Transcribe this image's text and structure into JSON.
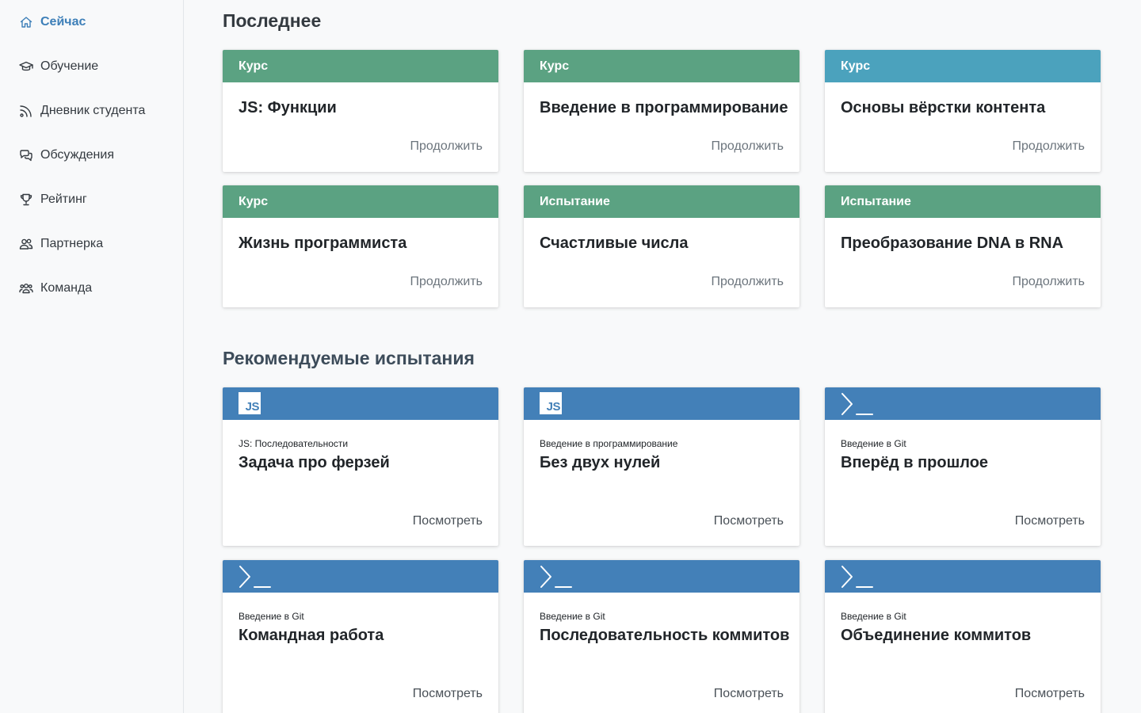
{
  "sidebar": {
    "items": [
      {
        "label": "Сейчас",
        "icon": "home-icon",
        "active": true
      },
      {
        "label": "Обучение",
        "icon": "graduation-cap-icon"
      },
      {
        "label": "Дневник студента",
        "icon": "feed-icon"
      },
      {
        "label": "Обсуждения",
        "icon": "chat-bubbles-icon"
      },
      {
        "label": "Рейтинг",
        "icon": "trophy-icon"
      },
      {
        "label": "Партнерка",
        "icon": "users-icon"
      },
      {
        "label": "Команда",
        "icon": "team-icon"
      }
    ]
  },
  "recent": {
    "title": "Последнее",
    "cards": [
      {
        "type": "Курс",
        "title": "JS: Функции",
        "action": "Продолжить",
        "color": "#5ba282"
      },
      {
        "type": "Курс",
        "title": "Введение в программирование",
        "action": "Продолжить",
        "color": "#5ba282"
      },
      {
        "type": "Курс",
        "title": "Основы вёрстки контента",
        "action": "Продолжить",
        "color": "#4ba2bd"
      },
      {
        "type": "Курс",
        "title": "Жизнь программиста",
        "action": "Продолжить",
        "color": "#5ba282"
      },
      {
        "type": "Испытание",
        "title": "Счастливые числа",
        "action": "Продолжить",
        "color": "#5ba282"
      },
      {
        "type": "Испытание",
        "title": "Преобразование DNA в RNA",
        "action": "Продолжить",
        "color": "#5ba282"
      }
    ]
  },
  "recommended": {
    "title": "Рекомендуемые испытания",
    "header_color": "#4380b8",
    "cards": [
      {
        "icon": "js-icon",
        "icon_text": "JS",
        "course": "JS: Последовательности",
        "title": "Задача про ферзей",
        "action": "Посмотреть"
      },
      {
        "icon": "js-icon",
        "icon_text": "JS",
        "course": "Введение в программирование",
        "title": "Без двух нулей",
        "action": "Посмотреть"
      },
      {
        "icon": "terminal-icon",
        "course": "Введение в Git",
        "title": "Вперёд в прошлое",
        "action": "Посмотреть"
      },
      {
        "icon": "terminal-icon",
        "course": "Введение в Git",
        "title": "Командная работа",
        "action": "Посмотреть"
      },
      {
        "icon": "terminal-icon",
        "course": "Введение в Git",
        "title": "Последовательность коммитов",
        "action": "Посмотреть"
      },
      {
        "icon": "terminal-icon",
        "course": "Введение в Git",
        "title": "Объединение коммитов",
        "action": "Посмотреть"
      }
    ]
  }
}
